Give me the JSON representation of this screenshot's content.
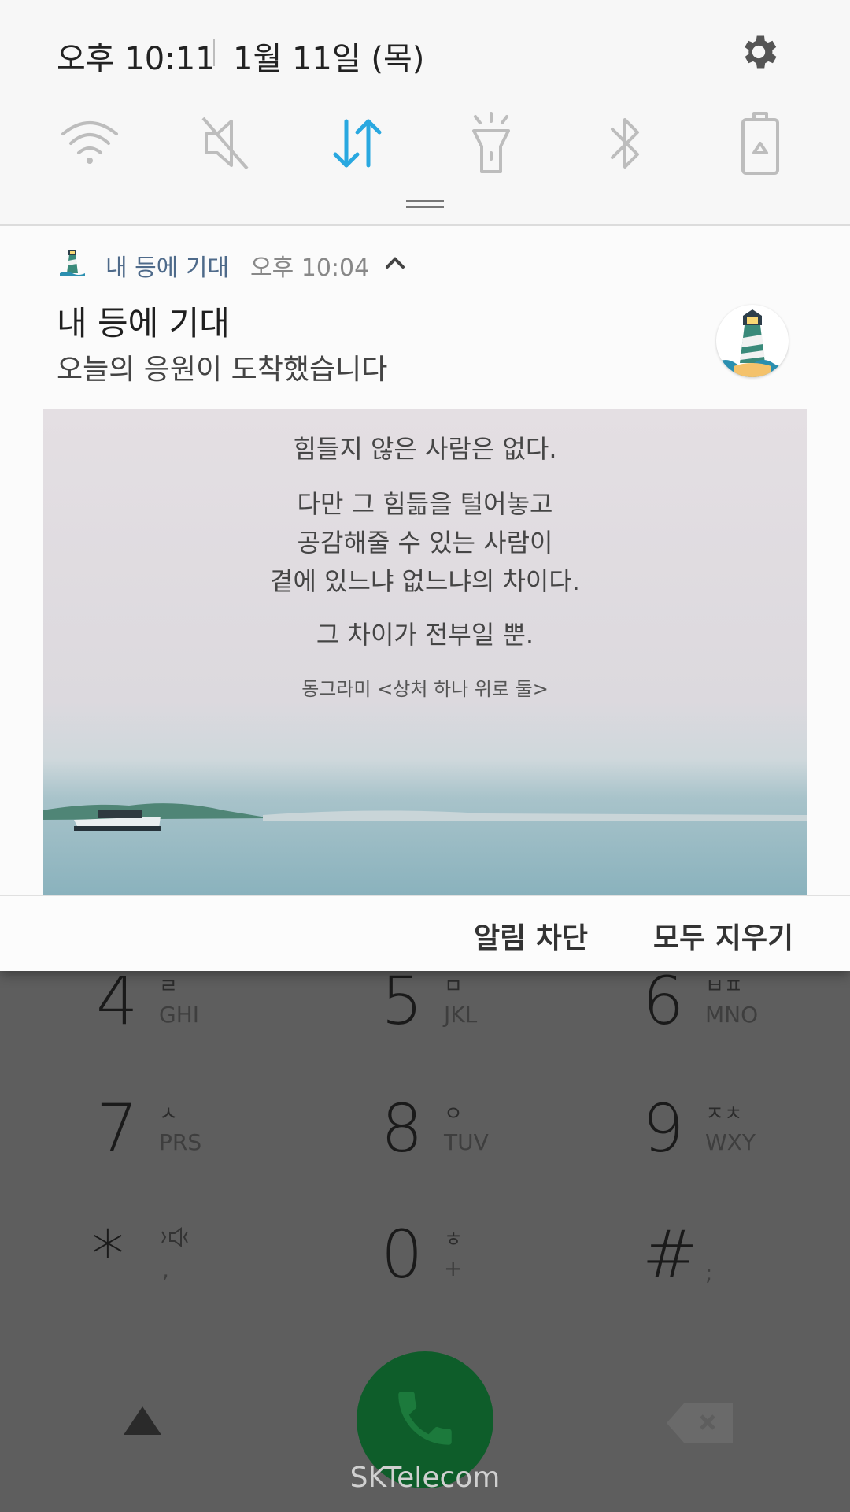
{
  "status_bar": {
    "time": "오후 10:11",
    "date": "1월 11일 (목)"
  },
  "quick_toggles": [
    {
      "icon": "wifi-icon",
      "active": false
    },
    {
      "icon": "mute-icon",
      "active": false
    },
    {
      "icon": "mobile-data-icon",
      "active": true
    },
    {
      "icon": "flashlight-icon",
      "active": false
    },
    {
      "icon": "bluetooth-icon",
      "active": false
    },
    {
      "icon": "power-saving-icon",
      "active": false
    }
  ],
  "notification": {
    "app_name": "내 등에 기대",
    "time": "오후 10:04",
    "title": "내 등에 기대",
    "text": "오늘의 응원이 도착했습니다",
    "picture_text": {
      "line1": "힘들지 않은 사람은 없다.",
      "line2": "다만 그 힘듦을 털어놓고",
      "line3": "공감해줄 수 있는 사람이",
      "line4": "곁에 있느냐 없느냐의 차이다.",
      "line5": "그 차이가 전부일 뿐.",
      "author": "동그라미 <상처 하나 위로 둘>"
    },
    "actions": {
      "block": "알림 차단",
      "clear_all": "모두 지우기"
    }
  },
  "dialer": {
    "keys": [
      {
        "digit": "4",
        "kor": "ㄹ",
        "lat": "GHI"
      },
      {
        "digit": "5",
        "kor": "ㅁ",
        "lat": "JKL"
      },
      {
        "digit": "6",
        "kor": "ㅂㅍ",
        "lat": "MNO"
      },
      {
        "digit": "7",
        "kor": "ㅅ",
        "lat": "PRS"
      },
      {
        "digit": "8",
        "kor": "ㅇ",
        "lat": "TUV"
      },
      {
        "digit": "9",
        "kor": "ㅈㅊ",
        "lat": "WXY"
      },
      {
        "digit": "*",
        "kor": "",
        "lat": ","
      },
      {
        "digit": "0",
        "kor": "ㅎ",
        "lat": "+"
      },
      {
        "digit": "#",
        "kor": "",
        "lat": ";"
      }
    ],
    "carrier": "SKTelecom"
  },
  "colors": {
    "accent": "#29a8e0",
    "toggle_inactive": "#bdbdbd",
    "app_name": "#4e6a8a",
    "call_button": "#0e5d2a",
    "dim_overlay": "#5e5e5e"
  }
}
